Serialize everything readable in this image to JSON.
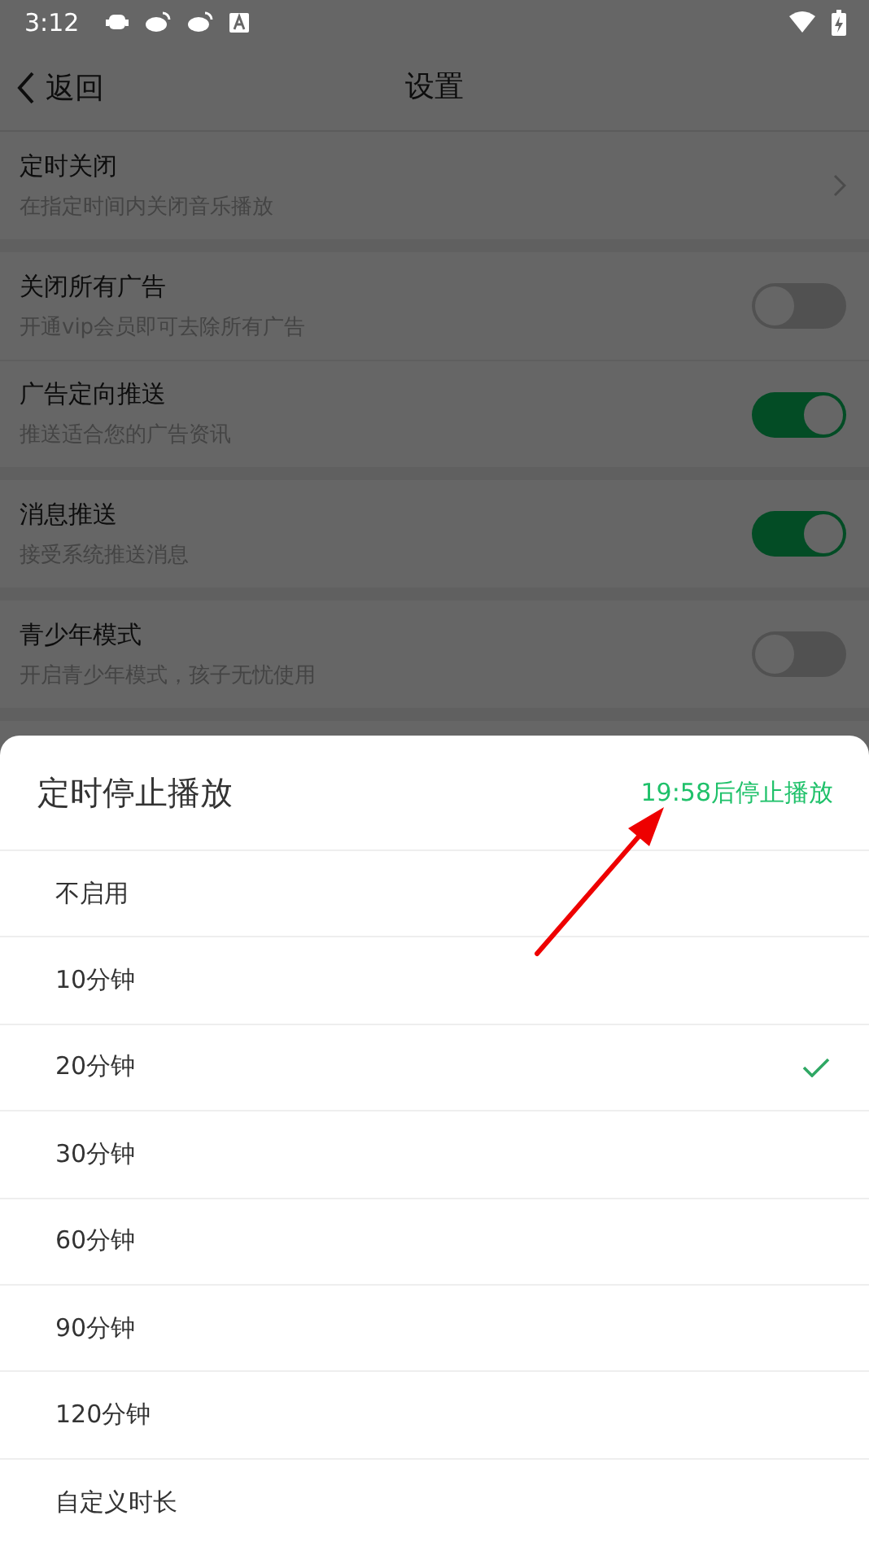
{
  "status_bar": {
    "time": "3:12"
  },
  "header": {
    "back": "返回",
    "title": "设置"
  },
  "groups": [
    [
      {
        "kind": "link",
        "title": "定时关闭",
        "subtitle": "在指定时间内关闭音乐播放"
      }
    ],
    [
      {
        "kind": "switch",
        "title": "关闭所有广告",
        "subtitle": "开通vip会员即可去除所有广告",
        "on": false
      },
      {
        "kind": "switch",
        "title": "广告定向推送",
        "subtitle": "推送适合您的广告资讯",
        "on": true
      }
    ],
    [
      {
        "kind": "switch",
        "title": "消息推送",
        "subtitle": "接受系统推送消息",
        "on": true
      }
    ],
    [
      {
        "kind": "switch",
        "title": "青少年模式",
        "subtitle": "开启青少年模式，孩子无忧使用",
        "on": false
      }
    ]
  ],
  "sheet": {
    "title": "定时停止播放",
    "status": "19:58后停止播放",
    "options": [
      {
        "label": "不启用",
        "selected": false
      },
      {
        "label": "10分钟",
        "selected": false
      },
      {
        "label": "20分钟",
        "selected": true
      },
      {
        "label": "30分钟",
        "selected": false
      },
      {
        "label": "60分钟",
        "selected": false
      },
      {
        "label": "90分钟",
        "selected": false
      },
      {
        "label": "120分钟",
        "selected": false
      },
      {
        "label": "自定义时长",
        "selected": false
      }
    ]
  }
}
